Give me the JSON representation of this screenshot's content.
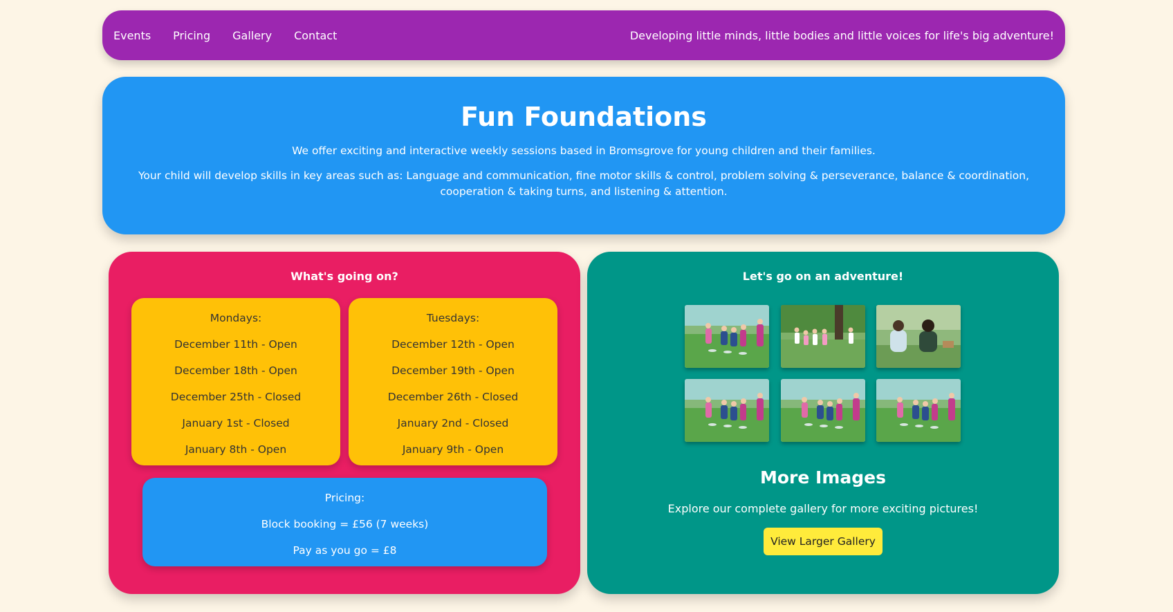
{
  "nav": {
    "links": [
      "Events",
      "Pricing",
      "Gallery",
      "Contact"
    ],
    "tagline": "Developing little minds, little bodies and little voices for life's big adventure!"
  },
  "hero": {
    "title": "Fun Foundations",
    "p1": "We offer exciting and interactive weekly sessions based in Bromsgrove for young children and their families.",
    "p2": "Your child will develop skills in key areas such as: Language and communication, fine motor skills & control, problem solving & perseverance, balance & coordination, cooperation & taking turns, and listening & attention."
  },
  "events": {
    "heading": "What's going on?",
    "mondays": {
      "title": "Mondays:",
      "dates": [
        "December 11th - Open",
        "December 18th - Open",
        "December 25th - Closed",
        "January 1st - Closed",
        "January 8th - Open"
      ]
    },
    "tuesdays": {
      "title": "Tuesdays:",
      "dates": [
        "December 12th - Open",
        "December 19th - Open",
        "December 26th - Closed",
        "January 2nd - Closed",
        "January 9th - Open"
      ]
    },
    "pricing": {
      "title": "Pricing:",
      "block": "Block booking = £56 (7 weeks)",
      "payg": "Pay as you go = £8"
    }
  },
  "gallery": {
    "heading": "Let's go on an adventure!",
    "more_title": "More Images",
    "more_desc": "Explore our complete gallery for more exciting pictures!",
    "button_label": "View Larger Gallery",
    "thumbnails": [
      "children-playing-photo",
      "children-running-photo",
      "children-sitting-photo",
      "children-playing-photo",
      "children-playing-photo",
      "children-playing-photo"
    ]
  },
  "colors": {
    "background": "#fdf5e6",
    "nav": "#9c27b0",
    "hero": "#2196f3",
    "events_panel": "#e91e63",
    "day_card": "#ffc107",
    "gallery_panel": "#009688",
    "button": "#ffeb3b"
  }
}
